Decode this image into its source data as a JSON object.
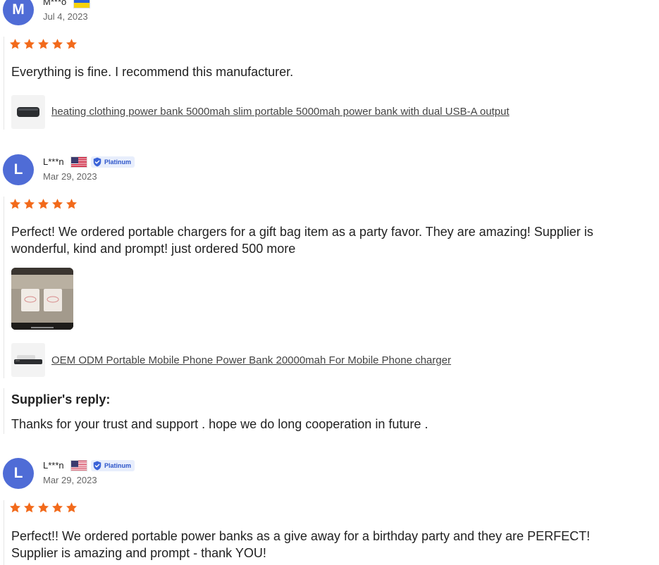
{
  "reviews": [
    {
      "initial": "M",
      "username": "M***o",
      "date": "Jul 4, 2023",
      "rating": 5,
      "text": "Everything is fine. I recommend this manufacturer.",
      "product_link": "heating clothing power bank 5000mah slim portable 5000mah power bank with dual USB-A output"
    },
    {
      "initial": "L",
      "username": "L***n",
      "badge": "Platinum",
      "date": "Mar 29, 2023",
      "rating": 5,
      "text_line1": "Perfect! We ordered portable chargers for a gift bag item as a party favor. They are amazing! Supplier is",
      "text_line2": "wonderful, kind and prompt! just ordered 500 more",
      "product_link": "OEM ODM Portable Mobile Phone Power Bank 20000mah For Mobile Phone charger",
      "supplier_reply_label": "Supplier's reply:",
      "supplier_reply": "Thanks for your trust and support . hope we do long cooperation in future ."
    },
    {
      "initial": "L",
      "username": "L***n",
      "badge": "Platinum",
      "date": "Mar 29, 2023",
      "rating": 5,
      "text_line1": "Perfect!! We ordered portable power banks as a give away for a birthday party and they are PERFECT!",
      "text_line2": "Supplier is amazing and prompt - thank YOU!"
    }
  ],
  "colors": {
    "star": "#f26a1b",
    "avatar": "#4f6cd6",
    "badge_bg": "#e8eefc",
    "badge_text": "#2d55c9"
  },
  "icons": {
    "star": "star-icon",
    "verified": "verified-shield-icon",
    "flag_ua": "ukraine-flag-icon",
    "flag_us": "usa-flag-icon"
  }
}
